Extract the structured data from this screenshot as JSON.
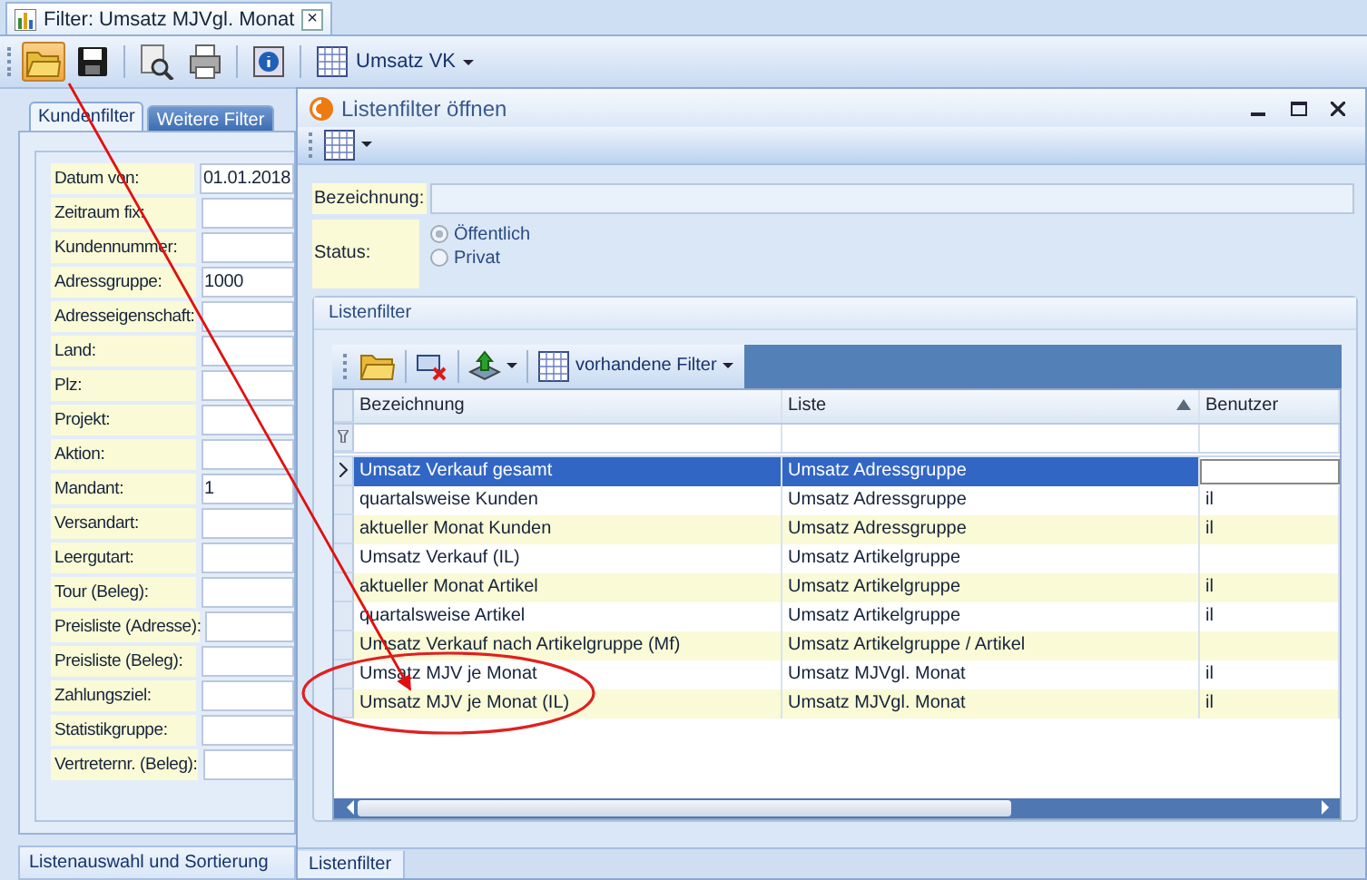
{
  "document_tab": {
    "title": "Filter: Umsatz MJVgl. Monat",
    "close": "×"
  },
  "toolbar": {
    "buttons": [
      {
        "kind": "folder",
        "selected": true
      },
      {
        "kind": "save",
        "selected": false
      },
      {
        "kind": "preview",
        "selected": false
      },
      {
        "kind": "printer",
        "selected": false
      },
      {
        "kind": "info",
        "selected": false
      }
    ],
    "layout_menu": "Umsatz VK"
  },
  "filter_tabs": [
    {
      "label": "Kundenfilter",
      "selected": true
    },
    {
      "label": "Weitere Filter",
      "selected": false
    }
  ],
  "fields": [
    {
      "label": "Datum von:",
      "value": "01.01.2018"
    },
    {
      "label": "Zeitraum fix:"
    },
    {
      "label": "Kundennummer:"
    },
    {
      "label": "Adressgruppe:",
      "value": "1000"
    },
    {
      "label": "Adresseigenschaft:"
    },
    {
      "label": "Land:"
    },
    {
      "label": "Plz:"
    },
    {
      "label": "Projekt:"
    },
    {
      "label": "Aktion:"
    },
    {
      "label": "Mandant:",
      "value": "1"
    },
    {
      "label": "Versandart:"
    },
    {
      "label": "Leergutart:"
    },
    {
      "label": "Tour (Beleg):"
    },
    {
      "label": "Preisliste (Adresse):"
    },
    {
      "label": "Preisliste (Beleg):"
    },
    {
      "label": "Zahlungsziel:"
    },
    {
      "label": "Statistikgruppe:"
    },
    {
      "label": "Vertreternr. (Beleg):"
    }
  ],
  "bottom_section": "Listenauswahl und Sortierung",
  "dialog": {
    "title": "Listenfilter öffnen",
    "name_label": "Bezeichnung:",
    "status_label": "Status:",
    "status_options": [
      {
        "label": "Öffentlich",
        "selected": true
      },
      {
        "label": "Privat",
        "selected": false
      }
    ],
    "group_title": "Listenfilter",
    "grid_menu": "vorhandene Filter",
    "columns": [
      {
        "label": "Bezeichnung",
        "sorted": false
      },
      {
        "label": "Liste",
        "sorted": true
      },
      {
        "label": "Benutzer",
        "sorted": false
      }
    ],
    "rows": [
      {
        "cells": [
          "Umsatz Verkauf gesamt",
          "Umsatz Adressgruppe",
          null
        ],
        "selected": true
      },
      {
        "cells": [
          "quartalsweise Kunden",
          "Umsatz Adressgruppe",
          "il"
        ],
        "selected": false
      },
      {
        "cells": [
          "aktueller Monat Kunden",
          "Umsatz Adressgruppe",
          "il"
        ],
        "selected": false
      },
      {
        "cells": [
          "Umsatz Verkauf (IL)",
          "Umsatz Artikelgruppe",
          null
        ],
        "selected": false
      },
      {
        "cells": [
          "aktueller Monat Artikel",
          "Umsatz Artikelgruppe",
          "il"
        ],
        "selected": false
      },
      {
        "cells": [
          "quartalsweise Artikel",
          "Umsatz Artikelgruppe",
          "il"
        ],
        "selected": false
      },
      {
        "cells": [
          "Umsatz Verkauf nach Artikelgruppe (Mf)",
          "Umsatz Artikelgruppe / Artikel",
          null
        ],
        "selected": false
      },
      {
        "cells": [
          "Umsatz MJV je Monat",
          "Umsatz MJVgl. Monat",
          "il"
        ],
        "selected": false
      },
      {
        "cells": [
          "Umsatz MJV je Monat (IL)",
          "Umsatz MJVgl. Monat",
          "il"
        ],
        "selected": false
      }
    ],
    "bottom_tab": "Listenfilter"
  }
}
